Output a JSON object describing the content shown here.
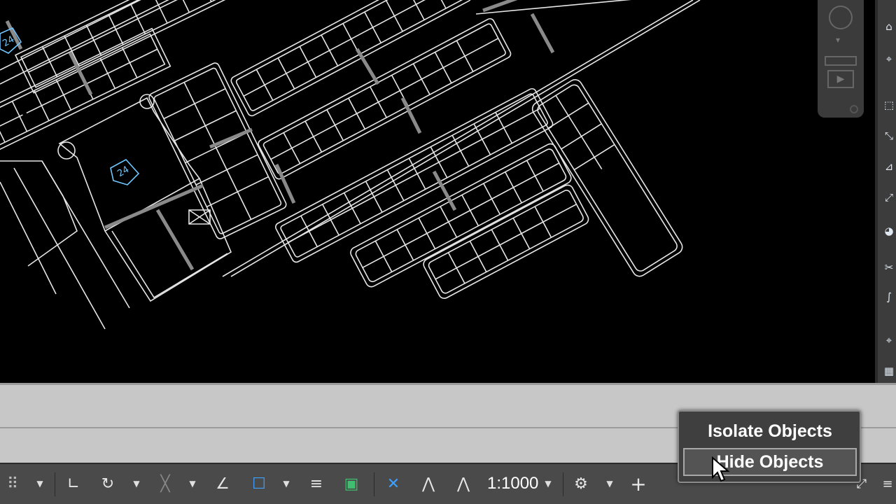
{
  "drawing": {
    "block_labels": [
      "24",
      "24"
    ]
  },
  "status_bar": {
    "annotation_scale": "1:1000",
    "items": [
      {
        "name": "grid-icon",
        "glyph": "⠿"
      },
      {
        "name": "ortho-icon",
        "glyph": "∟"
      },
      {
        "name": "polar-tracking-icon",
        "glyph": "↻"
      },
      {
        "name": "isodraft-icon",
        "glyph": "╳"
      },
      {
        "name": "dynamic-ucs-icon",
        "glyph": "∠"
      },
      {
        "name": "selection-cycling-icon",
        "glyph": "☐"
      },
      {
        "name": "lineweight-icon",
        "glyph": "≡"
      },
      {
        "name": "transparency-icon",
        "glyph": "▣"
      },
      {
        "name": "annotation-visibility-icon",
        "glyph": "✕"
      },
      {
        "name": "auto-scale-icon",
        "glyph": "⋀"
      },
      {
        "name": "annotation-scale-icon",
        "glyph": "⋀"
      },
      {
        "name": "workspace-gear-icon",
        "glyph": "⚙"
      },
      {
        "name": "annotation-monitor-icon",
        "glyph": "+"
      }
    ]
  },
  "context_menu": {
    "items": [
      "Isolate Objects",
      "Hide Objects"
    ]
  },
  "colors": {
    "canvas": "#000000",
    "linework": "#e6e6e6",
    "block_cyan": "#6fc6ff",
    "status_bar": "#4a4a4a",
    "command_line": "#c7c7c7",
    "accent_blue": "#3ea0ff"
  }
}
